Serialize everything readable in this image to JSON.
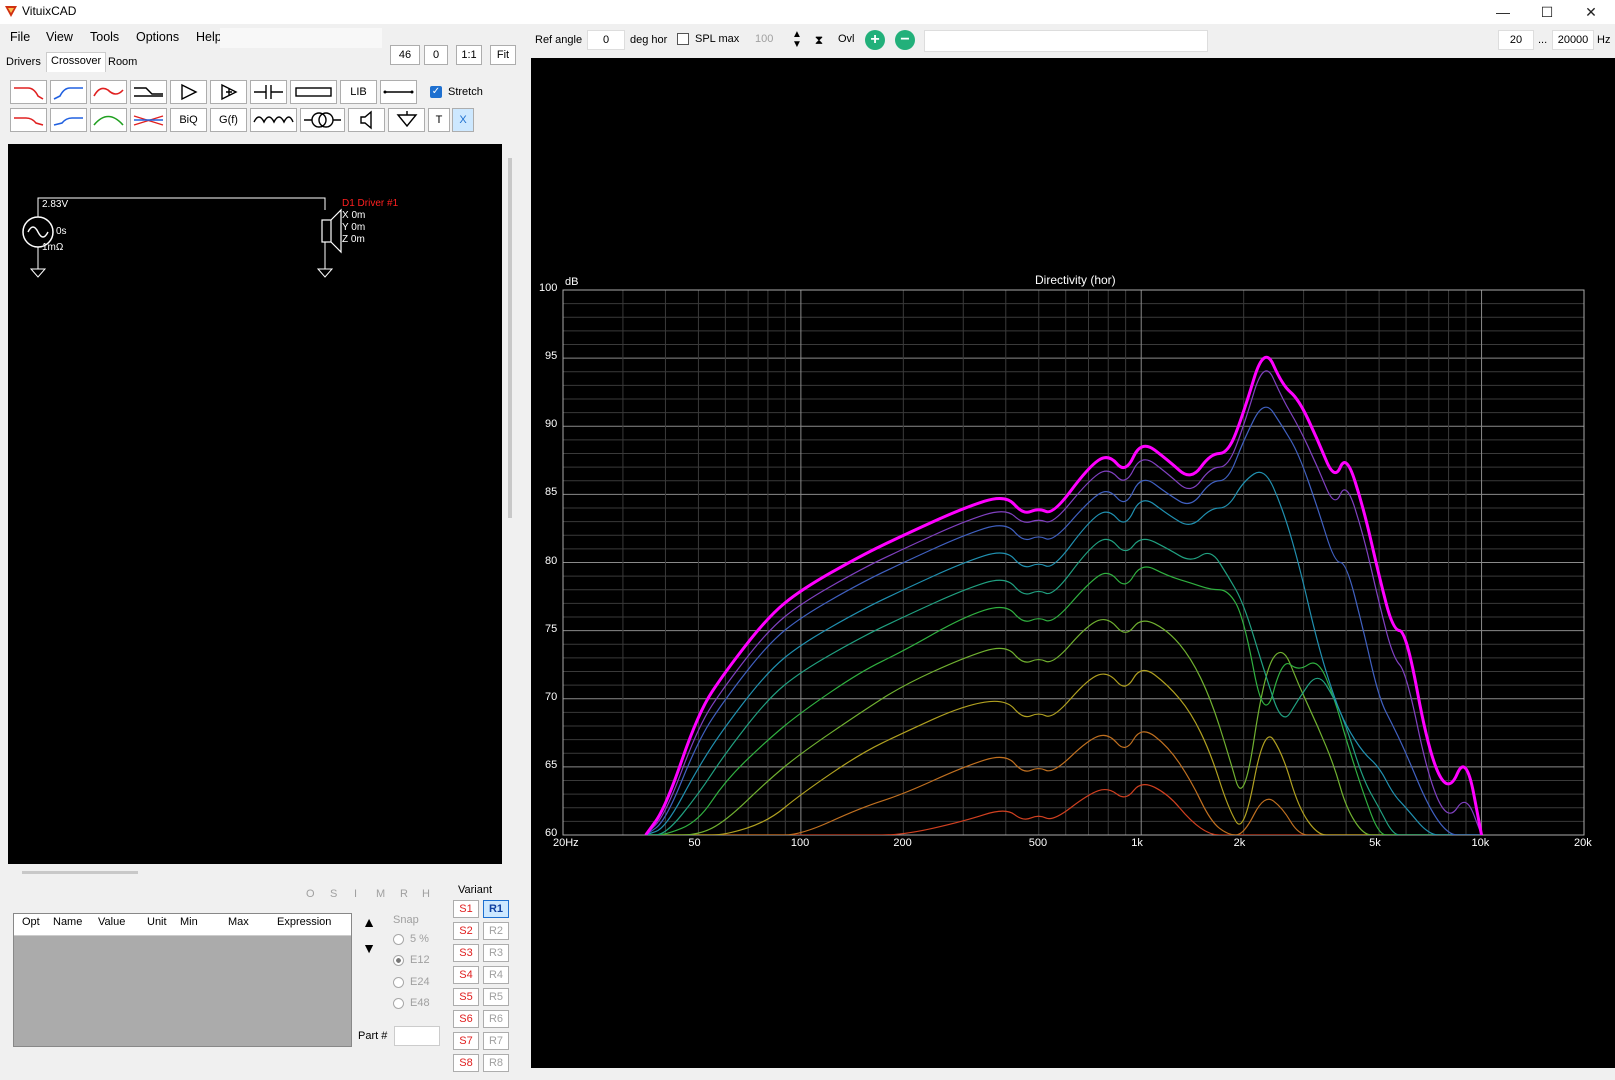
{
  "window": {
    "title": "VituixCAD",
    "min_icon": "minimize-icon",
    "max_icon": "maximize-icon",
    "close_icon": "close-icon"
  },
  "menu": [
    "File",
    "View",
    "Tools",
    "Options",
    "Help"
  ],
  "top_left_fields": {
    "v1": "46",
    "v2": "0",
    "btn_ratio": "1:1",
    "btn_fit": "Fit"
  },
  "tabs": [
    "Drivers",
    "Crossover",
    "Room"
  ],
  "active_tab": "Crossover",
  "toolbar_row1": [
    "lowpass-icon",
    "highpass-icon",
    "bandpass-icon",
    "shelf-icon",
    "buffer-icon",
    "amplifier-icon",
    "capacitor-icon",
    "resistor-icon",
    "LIB",
    "wire-icon"
  ],
  "toolbar_row2": [
    "lowpass2-icon",
    "highpass2-icon",
    "bandpass2-icon",
    "allpass-icon",
    "BiQ",
    "G(f)",
    "inductor-icon",
    "transformer-icon",
    "speaker-icon",
    "ground-icon",
    "T",
    "X"
  ],
  "stretch_label": "Stretch",
  "schematic": {
    "source_voltage": "2.83V",
    "source_delay": "0s",
    "source_impedance": "1mΩ",
    "driver_name": "D1 Driver #1",
    "driver_x": "X 0m",
    "driver_y": "Y 0m",
    "driver_z": "Z 0m"
  },
  "side_letters": [
    "O",
    "S",
    "I",
    "M",
    "R",
    "H"
  ],
  "table_headers": [
    "Opt",
    "Name",
    "Value",
    "Unit",
    "Min",
    "Max",
    "Expression"
  ],
  "snap": {
    "label": "Snap",
    "options": [
      "5 %",
      "E12",
      "E24",
      "E48"
    ],
    "selected": "E12"
  },
  "part_label": "Part #",
  "variant": {
    "label": "Variant",
    "s": [
      "S1",
      "S2",
      "S3",
      "S4",
      "S5",
      "S6",
      "S7",
      "S8"
    ],
    "r": [
      "R1",
      "R2",
      "R3",
      "R4",
      "R5",
      "R6",
      "R7",
      "R8"
    ],
    "active_r": "R1"
  },
  "plot_toolbar": {
    "ref_angle_label": "Ref angle",
    "ref_angle_value": "0",
    "deg_hor": "deg hor",
    "spl_max": "SPL max",
    "spl_max_value": "100",
    "ovl": "Ovl",
    "f_min": "20",
    "dots": "...",
    "f_max": "20000",
    "hz": "Hz"
  },
  "chart_data": {
    "type": "line",
    "title": "Directivity (hor)",
    "ylabel": "dB",
    "x_ticks": [
      "20Hz",
      "50",
      "100",
      "200",
      "500",
      "1k",
      "2k",
      "5k",
      "10k",
      "20k"
    ],
    "y_ticks": [
      "60",
      "65",
      "70",
      "75",
      "80",
      "85",
      "90",
      "95",
      "100"
    ],
    "xlim": [
      20,
      20000
    ],
    "ylim": [
      60,
      100
    ],
    "x_scale": "log",
    "grid": true,
    "series_colors": [
      "#ff00ff",
      "#8040c0",
      "#4060c0",
      "#2090b0",
      "#20a080",
      "#30b040",
      "#70b030",
      "#b0a020",
      "#c07020",
      "#d04020"
    ],
    "freqs": [
      35,
      40,
      50,
      60,
      80,
      100,
      150,
      200,
      300,
      400,
      450,
      500,
      550,
      700,
      800,
      900,
      1000,
      1200,
      1400,
      1600,
      1800,
      2000,
      2300,
      2600,
      2900,
      3300,
      3700,
      4000,
      4500,
      5000,
      5500,
      6000,
      7000,
      8000,
      9000,
      10000
    ],
    "series": [
      {
        "values": [
          60,
          62,
          69,
          72,
          76,
          78,
          80.5,
          82,
          84,
          85,
          83.5,
          84,
          83.5,
          87,
          88,
          86.5,
          89,
          87.5,
          86,
          88,
          88,
          91,
          96,
          93,
          92,
          89,
          86,
          88,
          84,
          79,
          75,
          75,
          66,
          63,
          66,
          60
        ]
      },
      {
        "values": [
          60,
          61.5,
          68,
          71,
          75,
          77,
          79.5,
          81,
          83,
          84,
          82.8,
          83.2,
          82.8,
          86,
          87,
          85.6,
          88,
          86.5,
          85,
          87,
          87,
          90,
          95,
          92,
          90,
          87,
          84,
          86,
          82,
          77,
          73,
          72,
          64,
          61,
          63,
          60
        ]
      },
      {
        "values": [
          60,
          61,
          67,
          70,
          74,
          76,
          78.5,
          80,
          82,
          83,
          81.5,
          82,
          81.5,
          84.5,
          85.5,
          84,
          86.5,
          85,
          84,
          86,
          86,
          89,
          92,
          90,
          88,
          84,
          80,
          80,
          75,
          70,
          68,
          66,
          62,
          60,
          60,
          60
        ]
      },
      {
        "values": [
          60,
          60.5,
          65,
          68,
          72,
          74,
          76.5,
          78,
          80,
          81,
          79.5,
          80,
          79.5,
          83,
          84,
          82.5,
          85,
          83.5,
          82.5,
          84,
          84,
          86,
          87,
          84,
          80,
          74,
          70,
          68,
          66,
          65,
          63,
          62,
          60,
          60,
          60,
          60
        ]
      },
      {
        "values": [
          60,
          60,
          63,
          66,
          70,
          72,
          74.5,
          76,
          78,
          79,
          77.5,
          78,
          77.5,
          81,
          82,
          80.5,
          82,
          81,
          80,
          81,
          79,
          77,
          72,
          68,
          70,
          72,
          70,
          68,
          64,
          62,
          60,
          60,
          60,
          60,
          60,
          60
        ]
      },
      {
        "values": [
          60,
          60,
          61,
          64,
          67,
          69,
          72,
          73.5,
          76,
          77,
          75.5,
          76,
          75.5,
          78.5,
          79.5,
          78,
          80,
          79,
          78.5,
          78,
          78,
          76,
          68,
          73,
          72,
          73,
          70,
          67,
          63,
          60,
          60,
          60,
          60,
          60,
          60,
          60
        ]
      },
      {
        "values": [
          60,
          60,
          60,
          61,
          64,
          66,
          69,
          71,
          73,
          74,
          72.5,
          73,
          72.5,
          75.5,
          76,
          74.5,
          76,
          75,
          73,
          70,
          66,
          62,
          72,
          74,
          71,
          68,
          65,
          62,
          60,
          60,
          60,
          60,
          60,
          60,
          60,
          60
        ]
      },
      {
        "values": [
          60,
          60,
          60,
          60,
          61,
          63,
          66,
          67.5,
          69.5,
          70,
          68.5,
          69,
          68.5,
          71.5,
          72,
          70.5,
          72.5,
          71,
          69,
          66,
          62,
          60,
          68,
          66,
          62,
          60,
          60,
          60,
          60,
          60,
          60,
          60,
          60,
          60,
          60,
          60
        ]
      },
      {
        "values": [
          60,
          60,
          60,
          60,
          60,
          60,
          62,
          63,
          65,
          66,
          64.5,
          65,
          64.5,
          67,
          67.5,
          66,
          68,
          66.5,
          64,
          61,
          60,
          60,
          63,
          62,
          60,
          60,
          60,
          60,
          60,
          60,
          60,
          60,
          60,
          60,
          60,
          60
        ]
      },
      {
        "values": [
          60,
          60,
          60,
          60,
          60,
          60,
          60,
          60,
          61,
          62,
          61,
          61.5,
          61,
          63,
          63.5,
          62.5,
          64,
          63,
          61,
          60,
          60,
          60,
          60,
          60,
          60,
          60,
          60,
          60,
          60,
          60,
          60,
          60,
          60,
          60,
          60,
          60
        ]
      }
    ]
  }
}
